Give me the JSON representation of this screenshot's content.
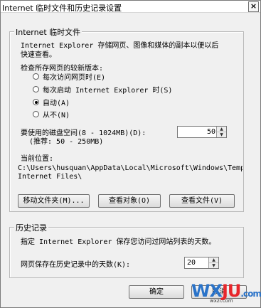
{
  "window": {
    "title": "Internet 临时文件和历史记录设置",
    "close_glyph": "×"
  },
  "temp_files": {
    "legend": "Internet 临时文件",
    "description_line1": "Internet Explorer 存储网页、图像和媒体的副本以便以后",
    "description_line2": "快速查看。",
    "check_label": "检查所存网页的较新版本:",
    "options": [
      {
        "label": "每次访问网页时(E)",
        "selected": false
      },
      {
        "label": "每次启动 Internet Explorer 时(S)",
        "selected": false
      },
      {
        "label": "自动(A)",
        "selected": true
      },
      {
        "label": "从不(N)",
        "selected": false
      }
    ],
    "disk_label": "要使用的磁盘空间(8 - 1024MB)(D):",
    "disk_hint": "(推荐: 50 - 250MB)",
    "disk_value": "50",
    "location_label": "当前位置:",
    "location_line1": "C:\\Users\\husquan\\AppData\\Local\\Microsoft\\Windows\\Temp",
    "location_line2": "Internet Files\\",
    "buttons": {
      "move": "移动文件夹(M)...",
      "view_objects": "查看对象(O)",
      "view_files": "查看文件(V)"
    }
  },
  "history": {
    "legend": "历史记录",
    "description": "指定 Internet Explorer 保存您访问过网站列表的天数。",
    "days_label": "网页保存在历史记录中的天数(K):",
    "days_value": "20"
  },
  "footer": {
    "ok": "确定",
    "cancel": "取消"
  },
  "watermark": {
    "text": "WXJU.com",
    "sub": "wxzi.com"
  },
  "colors": {
    "wm_a": "#2a73c9",
    "wm_b": "#e8262b"
  }
}
